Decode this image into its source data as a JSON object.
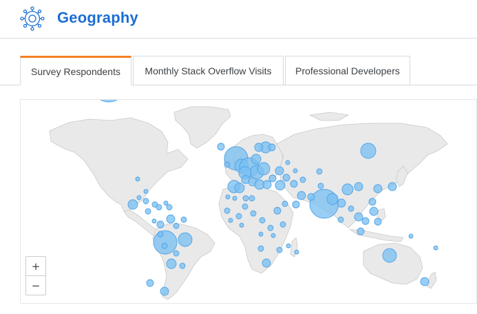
{
  "header": {
    "title": "Geography",
    "logo_icon": "globe-network-icon"
  },
  "tabs": [
    {
      "label": "Survey Respondents",
      "active": true
    },
    {
      "label": "Monthly Stack Overflow Visits",
      "active": false
    },
    {
      "label": "Professional Developers",
      "active": false
    }
  ],
  "map": {
    "zoom_in_label": "+",
    "zoom_out_label": "−",
    "colors": {
      "land": "#e9e9e9",
      "border": "#c9c9c9",
      "bubble_fill": "#7cc0f2",
      "bubble_stroke": "#4ea3e6",
      "accent_tab": "#f48024",
      "title": "#1b6ed3"
    }
  }
}
